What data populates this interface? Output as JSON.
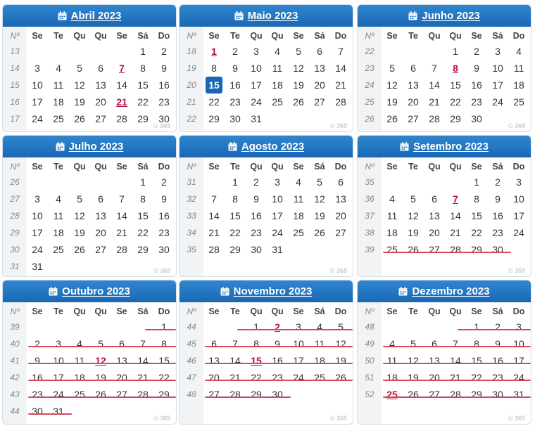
{
  "weekday_headers": [
    "Nº",
    "Se",
    "Te",
    "Qu",
    "Qu",
    "Se",
    "Sá",
    "Do"
  ],
  "watermark": "© 365",
  "colors": {
    "header": "#1a68b5",
    "holiday": "#b0123f",
    "today": "#1767b3",
    "strike": "#d6485a"
  },
  "months": [
    {
      "title": "Abril 2023",
      "weeks": [
        {
          "n": "13",
          "d": [
            "",
            "",
            "",
            "",
            "",
            "1",
            "2"
          ]
        },
        {
          "n": "14",
          "d": [
            "3",
            "4",
            "5",
            "6",
            "7",
            "8",
            "9"
          ],
          "hol": [
            4
          ]
        },
        {
          "n": "15",
          "d": [
            "10",
            "11",
            "12",
            "13",
            "14",
            "15",
            "16"
          ]
        },
        {
          "n": "16",
          "d": [
            "17",
            "18",
            "19",
            "20",
            "21",
            "22",
            "23"
          ],
          "hol": [
            4
          ]
        },
        {
          "n": "17",
          "d": [
            "24",
            "25",
            "26",
            "27",
            "28",
            "29",
            "30"
          ]
        }
      ]
    },
    {
      "title": "Maio 2023",
      "weeks": [
        {
          "n": "18",
          "d": [
            "1",
            "2",
            "3",
            "4",
            "5",
            "6",
            "7"
          ],
          "hol": [
            0
          ]
        },
        {
          "n": "19",
          "d": [
            "8",
            "9",
            "10",
            "11",
            "12",
            "13",
            "14"
          ]
        },
        {
          "n": "20",
          "d": [
            "15",
            "16",
            "17",
            "18",
            "19",
            "20",
            "21"
          ],
          "today": 0
        },
        {
          "n": "21",
          "d": [
            "22",
            "23",
            "24",
            "25",
            "26",
            "27",
            "28"
          ]
        },
        {
          "n": "22",
          "d": [
            "29",
            "30",
            "31",
            "",
            "",
            "",
            ""
          ]
        }
      ]
    },
    {
      "title": "Junho 2023",
      "weeks": [
        {
          "n": "22",
          "d": [
            "",
            "",
            "",
            "1",
            "2",
            "3",
            "4"
          ]
        },
        {
          "n": "23",
          "d": [
            "5",
            "6",
            "7",
            "8",
            "9",
            "10",
            "11"
          ],
          "hol": [
            3
          ]
        },
        {
          "n": "24",
          "d": [
            "12",
            "13",
            "14",
            "15",
            "16",
            "17",
            "18"
          ]
        },
        {
          "n": "25",
          "d": [
            "19",
            "20",
            "21",
            "22",
            "23",
            "24",
            "25"
          ]
        },
        {
          "n": "26",
          "d": [
            "26",
            "27",
            "28",
            "29",
            "30",
            "",
            ""
          ]
        }
      ]
    },
    {
      "title": "Julho 2023",
      "weeks": [
        {
          "n": "26",
          "d": [
            "",
            "",
            "",
            "",
            "",
            "1",
            "2"
          ]
        },
        {
          "n": "27",
          "d": [
            "3",
            "4",
            "5",
            "6",
            "7",
            "8",
            "9"
          ]
        },
        {
          "n": "28",
          "d": [
            "10",
            "11",
            "12",
            "13",
            "14",
            "15",
            "16"
          ]
        },
        {
          "n": "29",
          "d": [
            "17",
            "18",
            "19",
            "20",
            "21",
            "22",
            "23"
          ]
        },
        {
          "n": "30",
          "d": [
            "24",
            "25",
            "26",
            "27",
            "28",
            "29",
            "30"
          ]
        },
        {
          "n": "31",
          "d": [
            "31",
            "",
            "",
            "",
            "",
            "",
            ""
          ]
        }
      ]
    },
    {
      "title": "Agosto 2023",
      "weeks": [
        {
          "n": "31",
          "d": [
            "",
            "1",
            "2",
            "3",
            "4",
            "5",
            "6"
          ]
        },
        {
          "n": "32",
          "d": [
            "7",
            "8",
            "9",
            "10",
            "11",
            "12",
            "13"
          ]
        },
        {
          "n": "33",
          "d": [
            "14",
            "15",
            "16",
            "17",
            "18",
            "19",
            "20"
          ]
        },
        {
          "n": "34",
          "d": [
            "21",
            "22",
            "23",
            "24",
            "25",
            "26",
            "27"
          ]
        },
        {
          "n": "35",
          "d": [
            "28",
            "29",
            "30",
            "31",
            "",
            "",
            ""
          ]
        }
      ]
    },
    {
      "title": "Setembro 2023",
      "weeks": [
        {
          "n": "35",
          "d": [
            "",
            "",
            "",
            "",
            "1",
            "2",
            "3"
          ]
        },
        {
          "n": "36",
          "d": [
            "4",
            "5",
            "6",
            "7",
            "8",
            "9",
            "10"
          ],
          "hol": [
            3
          ]
        },
        {
          "n": "37",
          "d": [
            "11",
            "12",
            "13",
            "14",
            "15",
            "16",
            "17"
          ]
        },
        {
          "n": "38",
          "d": [
            "18",
            "19",
            "20",
            "21",
            "22",
            "23",
            "24"
          ]
        },
        {
          "n": "39",
          "d": [
            "25",
            "26",
            "27",
            "28",
            "29",
            "30",
            ""
          ],
          "strike": true
        }
      ]
    },
    {
      "title": "Outubro 2023",
      "weeks": [
        {
          "n": "39",
          "d": [
            "",
            "",
            "",
            "",
            "",
            "",
            "1"
          ],
          "strike": true
        },
        {
          "n": "40",
          "d": [
            "2",
            "3",
            "4",
            "5",
            "6",
            "7",
            "8"
          ],
          "strike": true
        },
        {
          "n": "41",
          "d": [
            "9",
            "10",
            "11",
            "12",
            "13",
            "14",
            "15"
          ],
          "hol": [
            3
          ],
          "strike": true
        },
        {
          "n": "42",
          "d": [
            "16",
            "17",
            "18",
            "19",
            "20",
            "21",
            "22"
          ],
          "strike": true
        },
        {
          "n": "43",
          "d": [
            "23",
            "24",
            "25",
            "26",
            "27",
            "28",
            "29"
          ],
          "strike": true
        },
        {
          "n": "44",
          "d": [
            "30",
            "31",
            "",
            "",
            "",
            "",
            ""
          ],
          "strike": true
        }
      ]
    },
    {
      "title": "Novembro 2023",
      "weeks": [
        {
          "n": "44",
          "d": [
            "",
            "",
            "1",
            "2",
            "3",
            "4",
            "5"
          ],
          "hol": [
            3
          ],
          "strike": true
        },
        {
          "n": "45",
          "d": [
            "6",
            "7",
            "8",
            "9",
            "10",
            "11",
            "12"
          ],
          "strike": true
        },
        {
          "n": "46",
          "d": [
            "13",
            "14",
            "15",
            "16",
            "17",
            "18",
            "19"
          ],
          "hol": [
            2
          ],
          "strike": true
        },
        {
          "n": "47",
          "d": [
            "20",
            "21",
            "22",
            "23",
            "24",
            "25",
            "26"
          ],
          "strike": true
        },
        {
          "n": "48",
          "d": [
            "27",
            "28",
            "29",
            "30",
            "",
            "",
            ""
          ],
          "strike": true
        }
      ]
    },
    {
      "title": "Dezembro 2023",
      "weeks": [
        {
          "n": "48",
          "d": [
            "",
            "",
            "",
            "",
            "1",
            "2",
            "3"
          ],
          "strike": true
        },
        {
          "n": "49",
          "d": [
            "4",
            "5",
            "6",
            "7",
            "8",
            "9",
            "10"
          ],
          "strike": true
        },
        {
          "n": "50",
          "d": [
            "11",
            "12",
            "13",
            "14",
            "15",
            "16",
            "17"
          ],
          "strike": true
        },
        {
          "n": "51",
          "d": [
            "18",
            "19",
            "20",
            "21",
            "22",
            "23",
            "24"
          ],
          "strike": true
        },
        {
          "n": "52",
          "d": [
            "25",
            "26",
            "27",
            "28",
            "29",
            "30",
            "31"
          ],
          "hol": [
            0
          ],
          "strike": true
        }
      ]
    }
  ]
}
